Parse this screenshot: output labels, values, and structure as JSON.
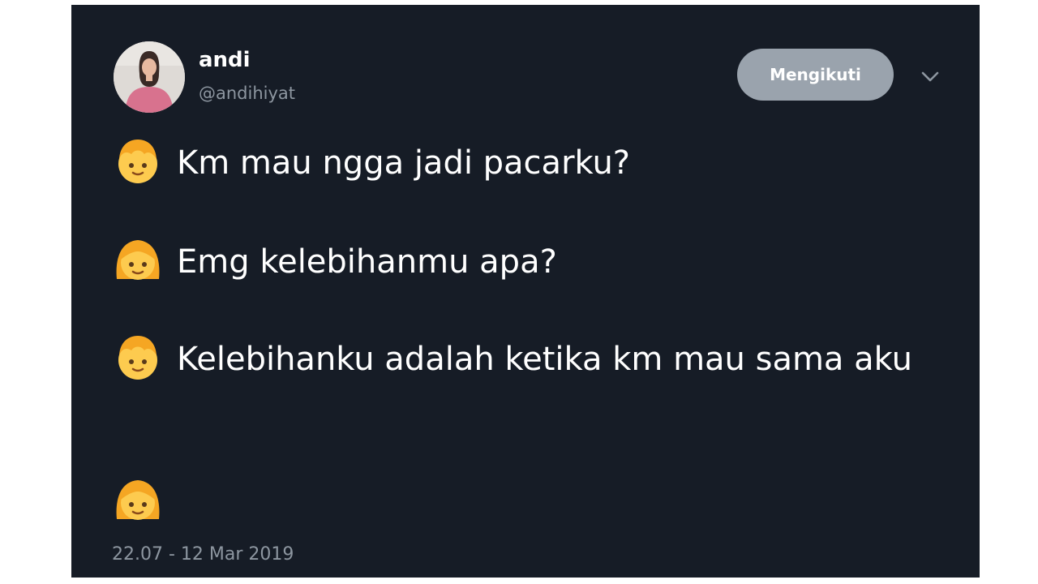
{
  "tweet": {
    "author": {
      "display_name": "andi",
      "handle": "@andihiyat"
    },
    "follow_button_label": "Mengikuti",
    "messages": [
      {
        "speaker_icon": "boy-emoji",
        "text": "Km mau ngga jadi pacarku?"
      },
      {
        "speaker_icon": "girl-emoji",
        "text": "Emg kelebihanmu apa?"
      },
      {
        "speaker_icon": "boy-emoji",
        "text": "Kelebihanku adalah ketika km mau sama aku"
      },
      {
        "speaker_icon": "girl-emoji",
        "text": ""
      }
    ],
    "timestamp": "22.07 - 12 Mar 2019"
  },
  "colors": {
    "card_background": "#161c26",
    "follow_button": "#9aa3ad",
    "muted_text": "#8d96a0"
  }
}
